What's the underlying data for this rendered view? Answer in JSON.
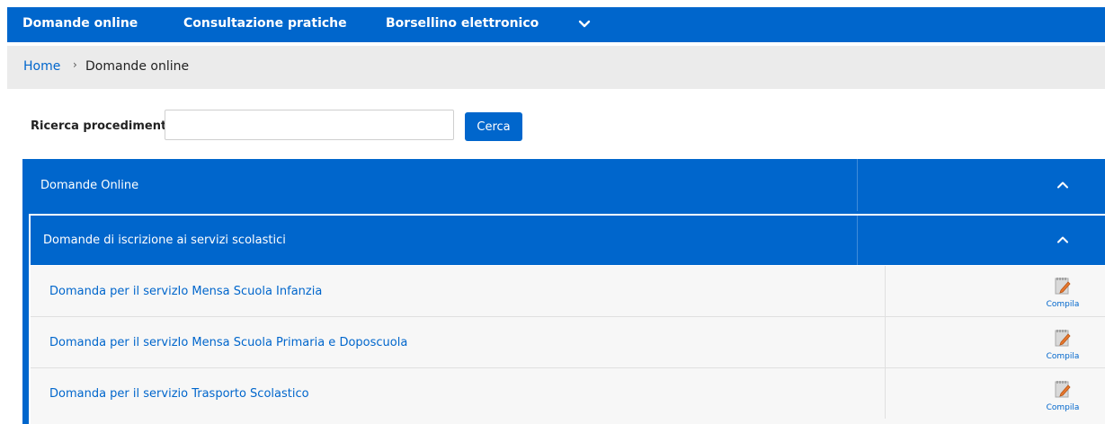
{
  "topnav": {
    "items": [
      {
        "label": "Domande online"
      },
      {
        "label": "Consultazione pratiche"
      },
      {
        "label": "Borsellino elettronico"
      }
    ],
    "more_icon": "chevron-down-icon"
  },
  "breadcrumb": {
    "home": "Home",
    "separator": "›",
    "current": "Domande online"
  },
  "search": {
    "label": "Ricerca procedimenti",
    "value": "",
    "placeholder": "",
    "button_label": "Cerca"
  },
  "accordion": {
    "title": "Domande Online",
    "toggle_icon": "chevron-up-icon",
    "section": {
      "title": "Domande di iscrizione ai servizi scolastici",
      "toggle_icon": "chevron-up-icon",
      "items": [
        {
          "label": "Domanda per il servizIo Mensa Scuola Infanzia",
          "action_label": "Compila",
          "action_icon": "edit-form-icon"
        },
        {
          "label": "Domanda per il servizIo Mensa Scuola Primaria e Doposcuola",
          "action_label": "Compila",
          "action_icon": "edit-form-icon"
        },
        {
          "label": "Domanda per il servizio Trasporto Scolastico",
          "action_label": "Compila",
          "action_icon": "edit-form-icon"
        }
      ]
    }
  },
  "colors": {
    "primary": "#0066cc",
    "breadcrumb_bg": "#ebebeb",
    "row_bg": "#f7f7f7"
  }
}
